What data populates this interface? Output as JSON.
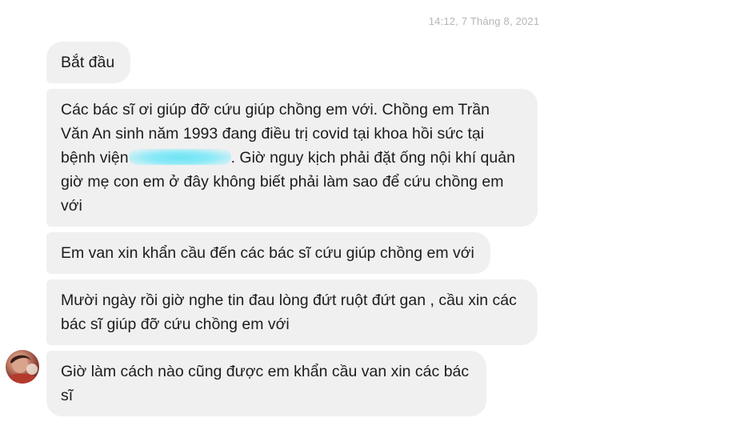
{
  "conversation": {
    "timestamp": "14:12, 7 Tháng 8, 2021",
    "messages": [
      {
        "text": "Bắt đầu"
      },
      {
        "text_before": "Các bác sĩ ơi giúp đỡ cứu giúp chồng em với. Chồng em Trần Văn An sinh năm 1993 đang điều trị covid tại khoa hồi sức tại bệnh viện",
        "text_after": ". Giờ nguy kịch phải đặt ống nội khí quản giờ mẹ con em ở đây không biết phải làm sao để cứu chồng em với"
      },
      {
        "text": "Em van xin khẩn cầu đến các bác sĩ cứu giúp chồng em với"
      },
      {
        "text": "Mười ngày rồi giờ nghe tin đau lòng đứt ruột đứt gan , cầu xin các bác sĩ giúp đỡ cứu chồng em với"
      },
      {
        "text": "Giờ làm cách nào cũng được em khẩn cầu van xin các bác sĩ"
      }
    ]
  },
  "colors": {
    "bubble_bg": "#f0f0f0",
    "text": "#1c1c1c",
    "timestamp": "#b5b5b5",
    "redaction": "#6fe3f4"
  },
  "icons": {
    "avatar": "sender-avatar"
  }
}
